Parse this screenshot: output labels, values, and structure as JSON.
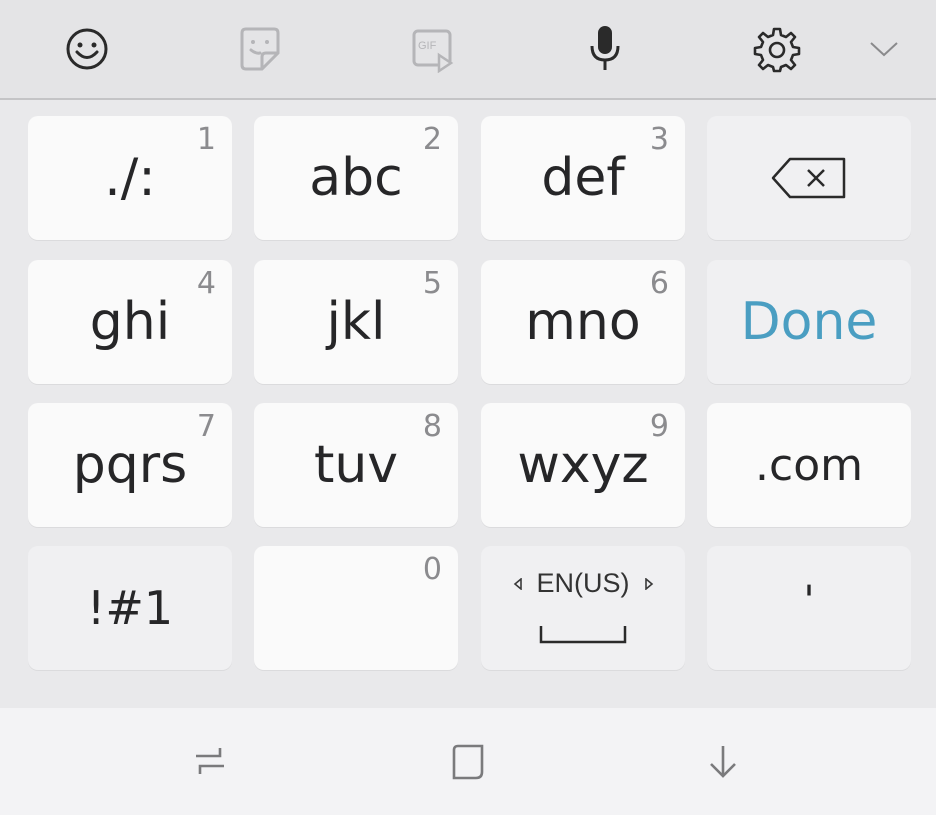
{
  "toolbar": {
    "icons": [
      "emoji-icon",
      "sticker-icon",
      "gif-icon",
      "microphone-icon",
      "settings-icon",
      "chevron-down-icon"
    ],
    "gif_label": "GIF"
  },
  "keys": {
    "k1": {
      "label": "./:",
      "num": "1"
    },
    "k2": {
      "label": "abc",
      "num": "2"
    },
    "k3": {
      "label": "def",
      "num": "3"
    },
    "k4": {
      "label": "ghi",
      "num": "4"
    },
    "k5": {
      "label": "jkl",
      "num": "5"
    },
    "k6": {
      "label": "mno",
      "num": "6"
    },
    "k7": {
      "label": "pqrs",
      "num": "7"
    },
    "k8": {
      "label": "tuv",
      "num": "8"
    },
    "k9": {
      "label": "wxyz",
      "num": "9"
    },
    "k0": {
      "label": "",
      "num": "0"
    },
    "done": {
      "label": "Done"
    },
    "dotcom": {
      "label": ".com"
    },
    "symbols": {
      "label": "!#1"
    },
    "language": {
      "label": "EN(US)"
    },
    "apostrophe": {
      "label": "'"
    }
  },
  "colors": {
    "accent": "#4a9ec2",
    "key_bg": "#fafafa",
    "func_key_bg": "#f0f0f2",
    "keyboard_bg": "#e9e9eb"
  }
}
